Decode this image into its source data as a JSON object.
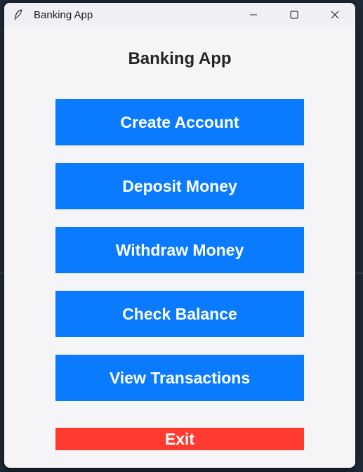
{
  "window": {
    "title": "Banking App",
    "icon": "feather-icon",
    "controls": [
      "minimize-icon",
      "maximize-icon",
      "close-icon"
    ]
  },
  "main": {
    "heading": "Banking App",
    "buttons": [
      {
        "label": "Create Account"
      },
      {
        "label": "Deposit Money"
      },
      {
        "label": "Withdraw Money"
      },
      {
        "label": "Check Balance"
      },
      {
        "label": "View Transactions"
      }
    ],
    "exit_label": "Exit"
  },
  "colors": {
    "primary_button": "#0a7bff",
    "exit_button": "#ff3b2f",
    "window_background": "#f5f4f7"
  }
}
